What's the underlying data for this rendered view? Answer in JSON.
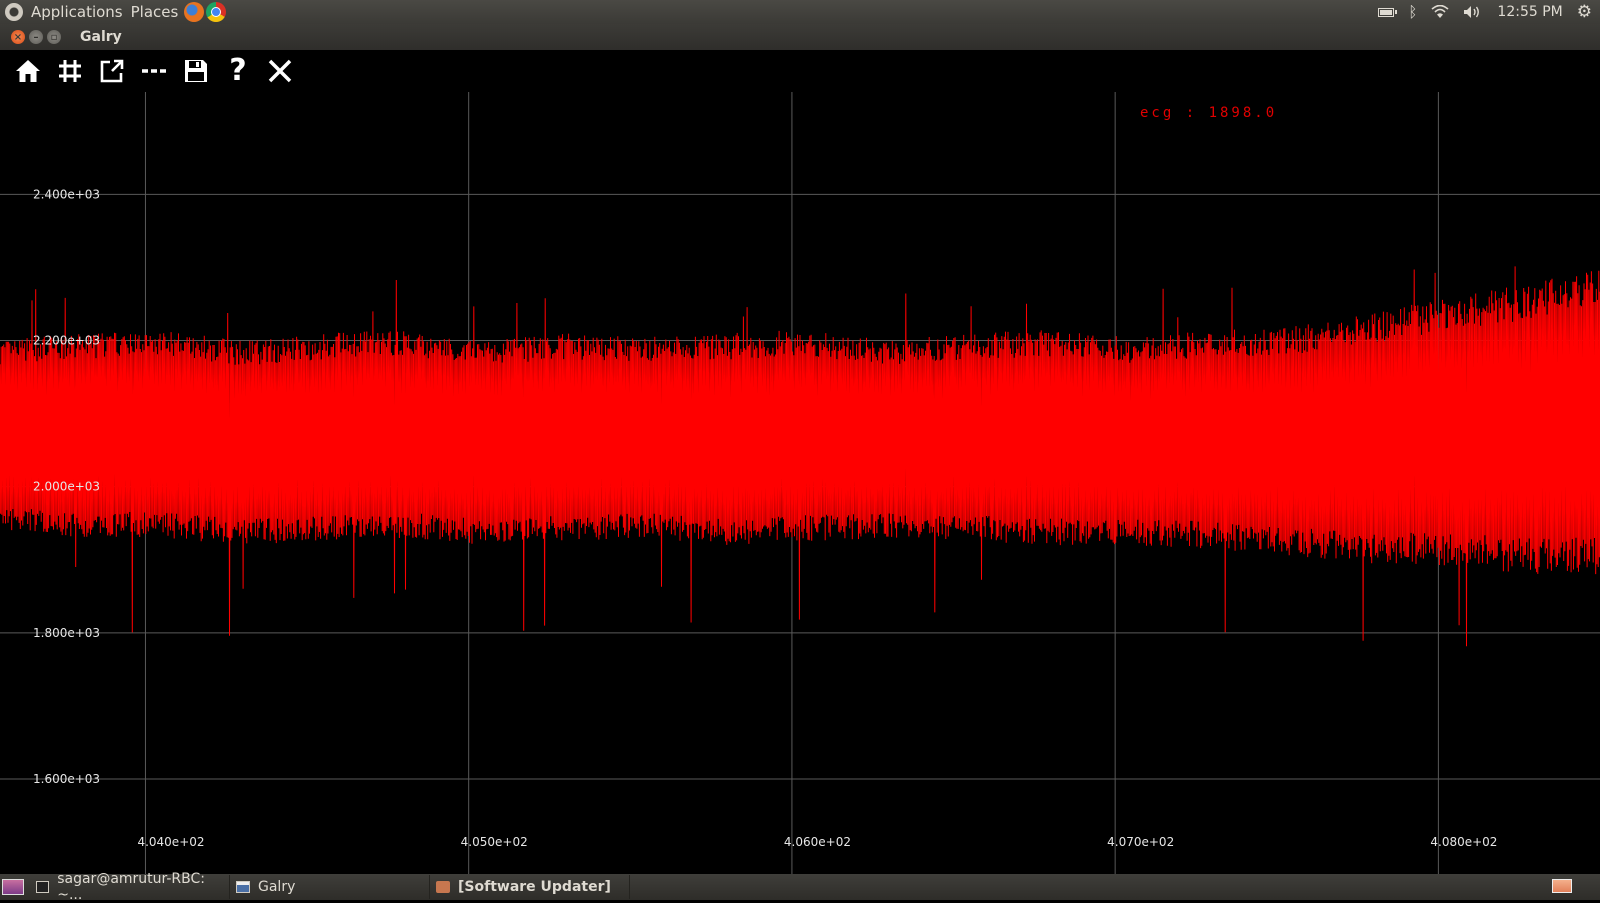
{
  "top_panel": {
    "menus": [
      "Applications",
      "Places"
    ],
    "clock": "12:55 PM"
  },
  "window": {
    "title": "Galry",
    "controls": {
      "close": "×",
      "minimize": "–",
      "maximize": "▫"
    }
  },
  "toolbar": {
    "buttons": [
      "home",
      "grid",
      "popout",
      "dashes",
      "save",
      "help",
      "close"
    ],
    "help_glyph": "?"
  },
  "chart_data": {
    "type": "line",
    "annotation": "ecg : 1898.0",
    "series_color": "#ff0000",
    "xlim": [
      403.55,
      408.5
    ],
    "ylim": [
      1470,
      2540
    ],
    "x_ticks": [
      404.0,
      405.0,
      406.0,
      407.0,
      408.0
    ],
    "x_tick_labels": [
      "4.040e+02",
      "4.050e+02",
      "4.060e+02",
      "4.070e+02",
      "4.080e+02"
    ],
    "y_ticks": [
      2400,
      2200,
      2000,
      1800,
      1600
    ],
    "y_tick_labels": [
      "2.400e+03",
      "2.200e+03",
      "2.000e+03",
      "1.800e+03",
      "1.600e+03"
    ],
    "grid": true,
    "series": [
      {
        "x": [
          403.55,
          403.8,
          404.05,
          404.3,
          404.55,
          404.8,
          405.05,
          405.3,
          405.55,
          405.8,
          406.05,
          406.3,
          406.55,
          406.8,
          407.05,
          407.3,
          407.55,
          407.8,
          408.05,
          408.3,
          408.5
        ],
        "y_min": [
          1940,
          1930,
          1930,
          1920,
          1925,
          1930,
          1920,
          1925,
          1930,
          1920,
          1925,
          1930,
          1925,
          1920,
          1920,
          1915,
          1905,
          1895,
          1890,
          1880,
          1880
        ],
        "y_max": [
          2200,
          2210,
          2215,
          2200,
          2210,
          2215,
          2200,
          2210,
          2205,
          2210,
          2215,
          2200,
          2210,
          2215,
          2205,
          2215,
          2220,
          2240,
          2260,
          2280,
          2300
        ]
      }
    ]
  },
  "taskbar": {
    "tasks": [
      "sagar@amrutur-RBC: ~...",
      "Galry",
      "[Software Updater]"
    ]
  }
}
